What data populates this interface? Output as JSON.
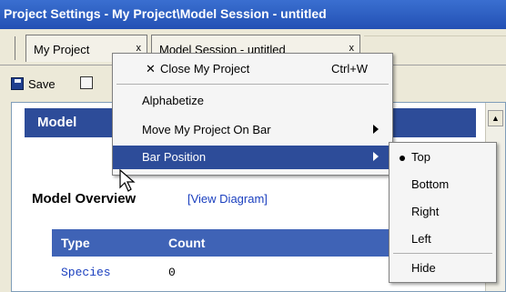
{
  "window": {
    "title": "Project Settings - My Project\\Model Session - untitled"
  },
  "tabs": [
    {
      "label": "My Project",
      "close": "x"
    },
    {
      "label": "Model Session - untitled",
      "close": "x"
    }
  ],
  "toolbar": {
    "save_label": "Save",
    "save_icon": "floppy-disk-icon",
    "print_icon": "printer-icon"
  },
  "panel": {
    "header": "Model",
    "overview_title": "Model Overview",
    "view_diagram_link": "[View Diagram]",
    "table": {
      "columns": [
        "Type",
        "Count"
      ],
      "rows": [
        {
          "type": "Species",
          "count": "0"
        }
      ]
    }
  },
  "context_menu": {
    "items": [
      {
        "label": "Close My Project",
        "accel": "Ctrl+W",
        "icon": "close-icon"
      },
      {
        "label": "Alphabetize"
      },
      {
        "label": "Move My Project On Bar",
        "submenu": true
      },
      {
        "label": "Bar Position",
        "submenu": true,
        "highlighted": true
      }
    ]
  },
  "bar_position_submenu": {
    "items": [
      {
        "label": "Top",
        "selected": true
      },
      {
        "label": "Bottom"
      },
      {
        "label": "Right"
      },
      {
        "label": "Left"
      },
      {
        "label": "Hide"
      }
    ]
  },
  "colors": {
    "title_bar": "#2350b4",
    "panel_header": "#2d4c99",
    "table_header": "#3f63b6",
    "link": "#1a3fbf",
    "menu_highlight": "#2d4c99"
  }
}
